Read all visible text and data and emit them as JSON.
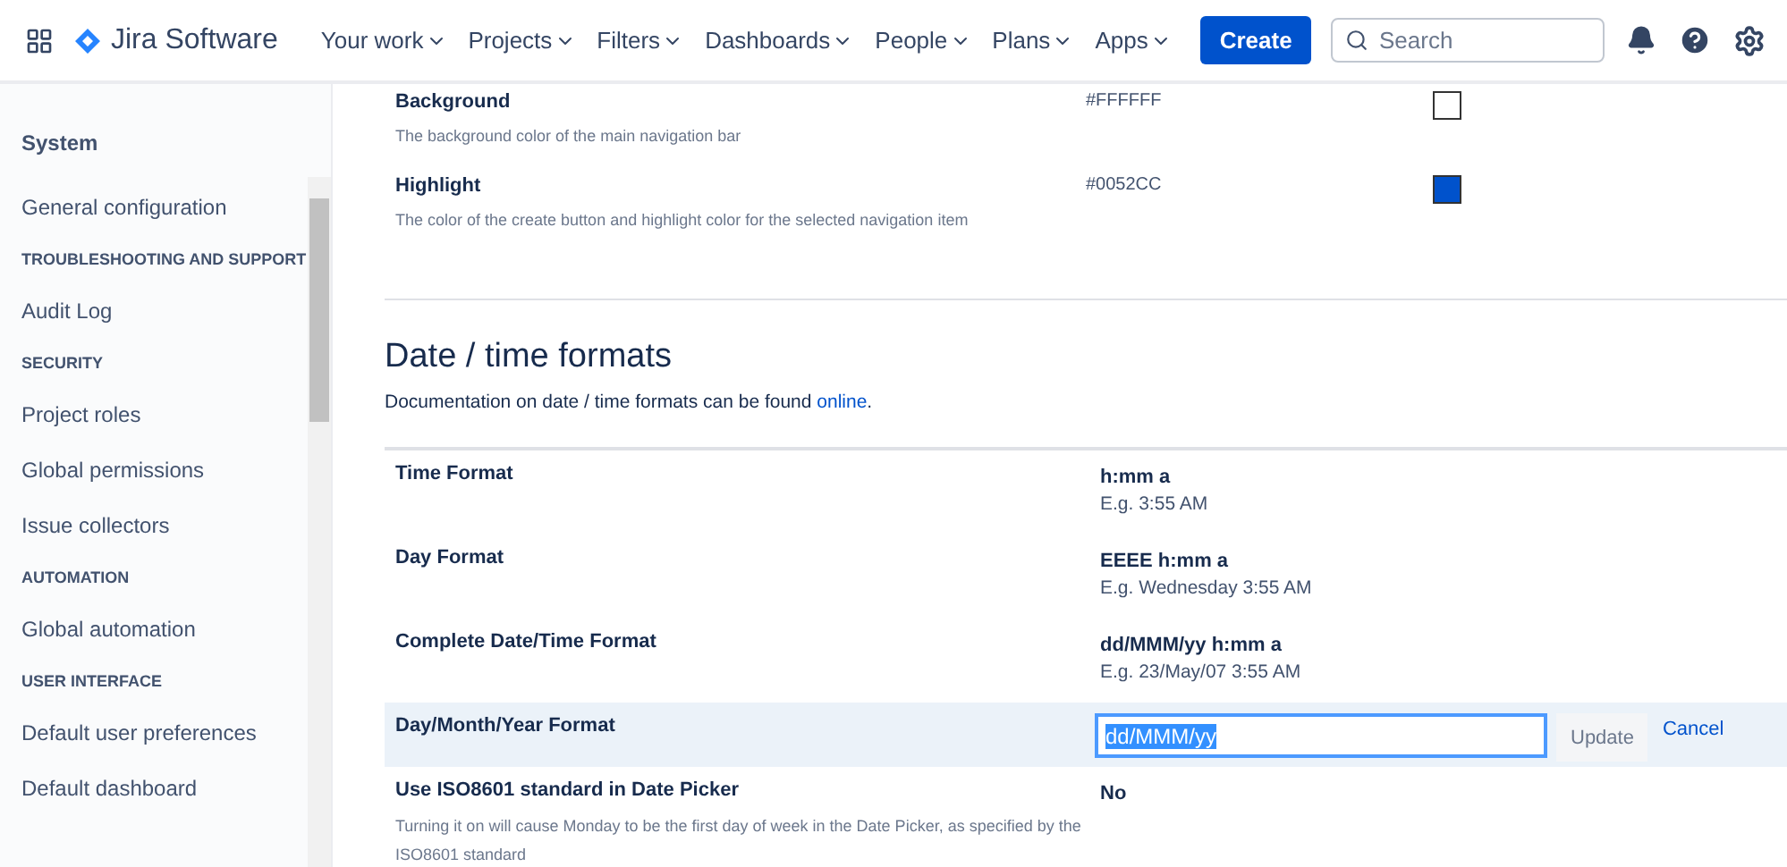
{
  "topnav": {
    "product": "Jira Software",
    "menus": [
      "Your work",
      "Projects",
      "Filters",
      "Dashboards",
      "People",
      "Plans",
      "Apps"
    ],
    "create": "Create",
    "search": {
      "placeholder": "Search"
    }
  },
  "sidebar": {
    "title": "System",
    "items": [
      {
        "kind": "link",
        "label": "General configuration"
      },
      {
        "kind": "heading",
        "label": "TROUBLESHOOTING AND SUPPORT"
      },
      {
        "kind": "link",
        "label": "Audit Log"
      },
      {
        "kind": "heading",
        "label": "SECURITY"
      },
      {
        "kind": "link",
        "label": "Project roles"
      },
      {
        "kind": "link",
        "label": "Global permissions"
      },
      {
        "kind": "link",
        "label": "Issue collectors"
      },
      {
        "kind": "heading",
        "label": "AUTOMATION"
      },
      {
        "kind": "link",
        "label": "Global automation"
      },
      {
        "kind": "heading",
        "label": "USER INTERFACE"
      },
      {
        "kind": "link",
        "label": "Default user preferences"
      },
      {
        "kind": "link",
        "label": "Default dashboard"
      }
    ]
  },
  "colors": [
    {
      "label": "Background",
      "description": "The background color of the main navigation bar",
      "value": "#FFFFFF",
      "color": "#ffffff"
    },
    {
      "label": "Highlight",
      "description": "The color of the create button and highlight color for the selected navigation item",
      "value": "#0052CC",
      "color": "#0052cc"
    }
  ],
  "section": {
    "title": "Date / time formats",
    "doc": "Documentation on date / time formats can be found ",
    "doc_link": "online",
    "doc_end": "."
  },
  "formats": [
    {
      "kind": "value",
      "label": "Time Format",
      "value": "h:mm a",
      "example": "E.g. 3:55 AM"
    },
    {
      "kind": "value",
      "label": "Day Format",
      "value": "EEEE h:mm a",
      "example": "E.g. Wednesday 3:55 AM"
    },
    {
      "kind": "value",
      "label": "Complete Date/Time Format",
      "value": "dd/MMM/yy h:mm a",
      "example": "E.g. 23/May/07 3:55 AM"
    },
    {
      "kind": "edit",
      "label": "Day/Month/Year Format",
      "value": "dd/MMM/yy",
      "update": "Update",
      "cancel": "Cancel"
    },
    {
      "kind": "value",
      "label": "Use ISO8601 standard in Date Picker",
      "value": "No",
      "description": "Turning it on will cause Monday to be the first day of week in the Date Picker, as specified by the ISO8601 standard"
    }
  ]
}
